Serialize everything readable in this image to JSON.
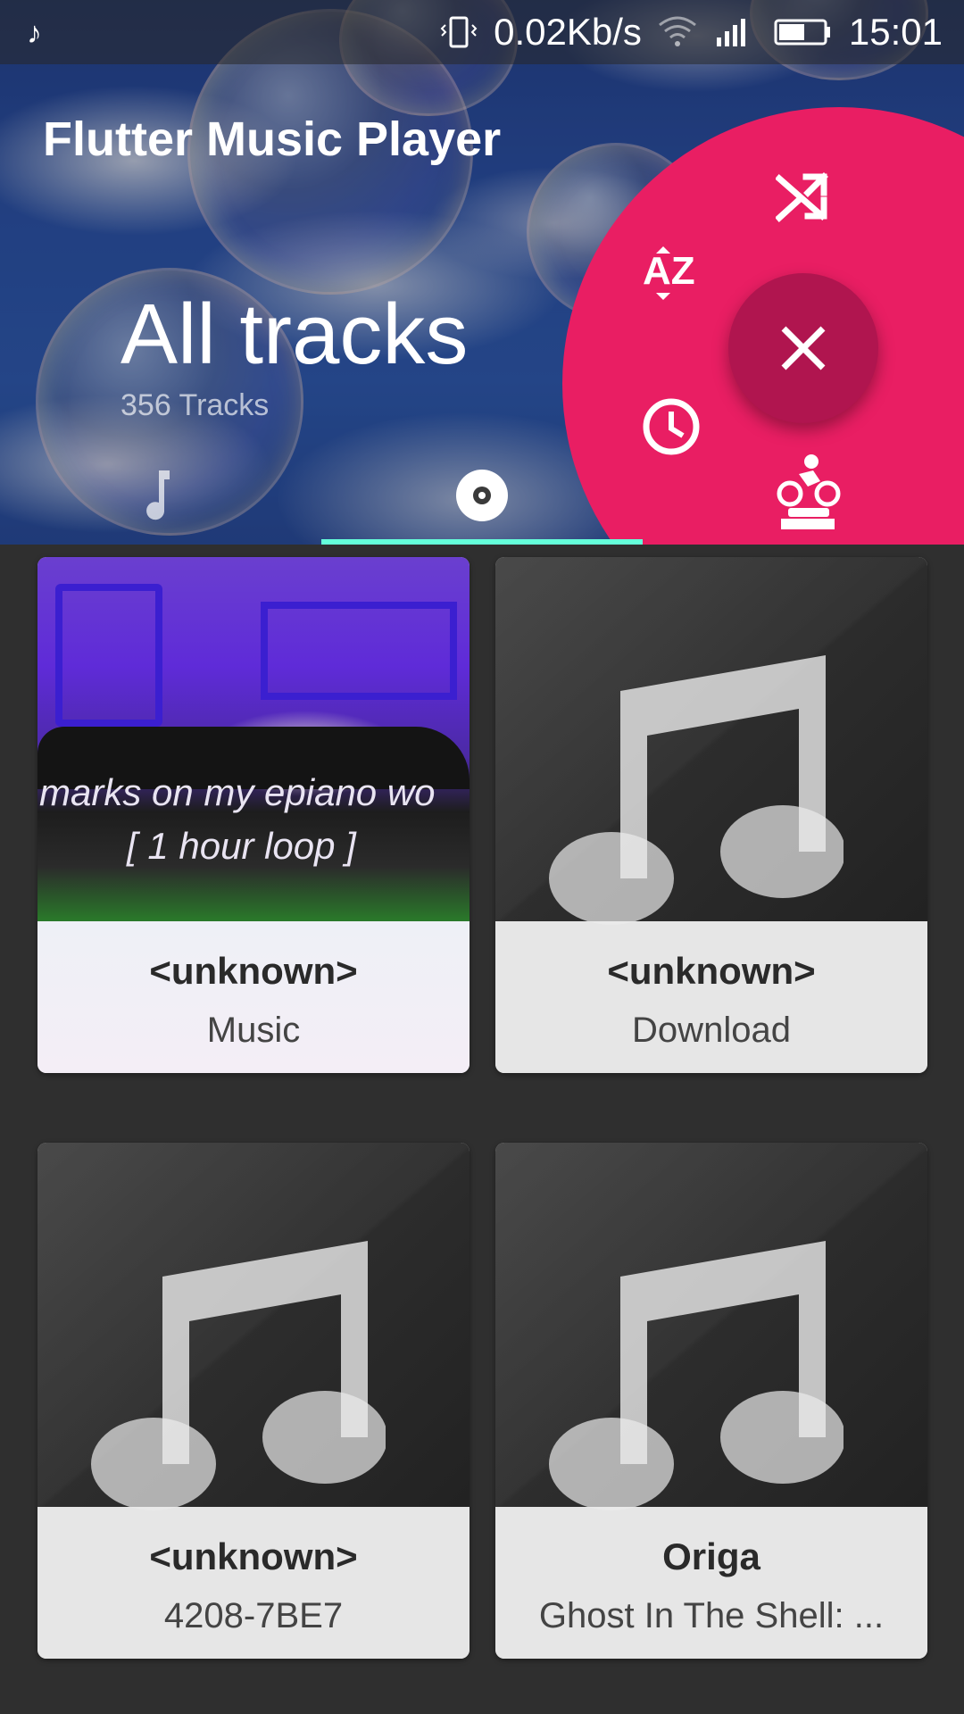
{
  "status_bar": {
    "notification_icon": "music-note-icon",
    "net_speed": "0.02Kb/s",
    "time": "15:01",
    "icons": [
      "vibrate-icon",
      "wifi-icon",
      "signal-icon",
      "battery-icon"
    ]
  },
  "header": {
    "app_title": "Flutter Music Player",
    "section_title": "All tracks",
    "section_subtitle": "356 Tracks"
  },
  "tabs": [
    {
      "icon": "music-note-icon",
      "selected": false
    },
    {
      "icon": "album-icon",
      "selected": true
    }
  ],
  "fab_menu": {
    "items": [
      "shuffle-icon",
      "sort-az-icon",
      "recent-clock-icon",
      "artist-icon"
    ],
    "close_icon": "close-icon",
    "colors": {
      "menu": "#e91e63",
      "fab": "#b0154f",
      "indicator": "#64ffda"
    }
  },
  "albums": [
    {
      "title": "<unknown>",
      "subtitle": "Music",
      "art_text_line1": "marks on my epiano wo",
      "art_text_line2": "[ 1 hour loop ]"
    },
    {
      "title": "<unknown>",
      "subtitle": "Download"
    },
    {
      "title": "<unknown>",
      "subtitle": "4208-7BE7"
    },
    {
      "title": "Origa",
      "subtitle": "Ghost In The Shell: ..."
    }
  ]
}
